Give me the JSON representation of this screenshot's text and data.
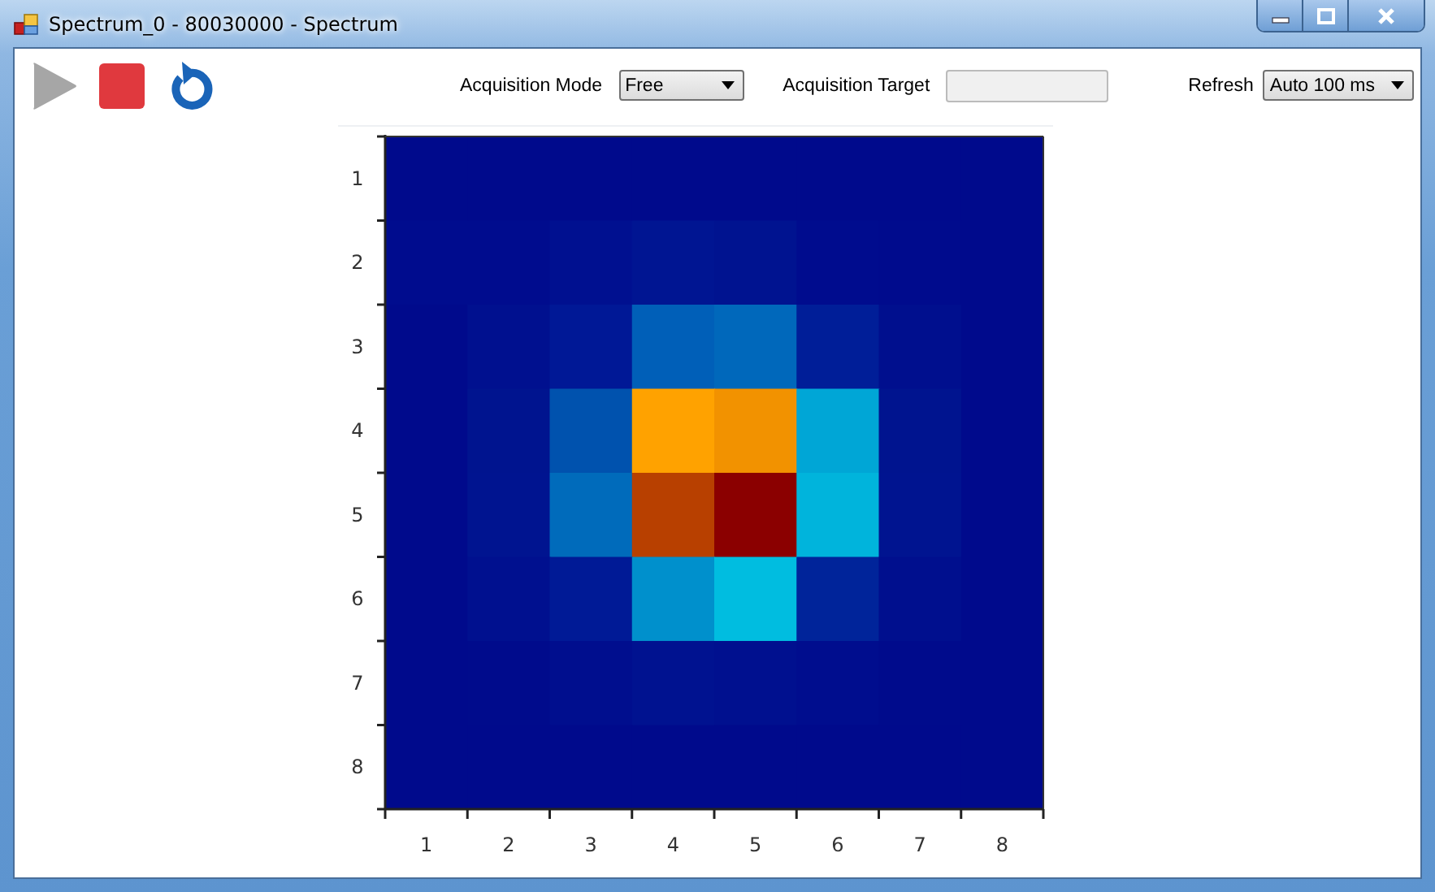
{
  "window": {
    "title": "Spectrum_0 - 80030000 - Spectrum"
  },
  "toolbar": [
    {
      "kind": "play",
      "disabled": true
    },
    {
      "kind": "stop",
      "disabled": false
    },
    {
      "kind": "reset",
      "disabled": false
    }
  ],
  "acquisition_mode": {
    "label": "Acquisition Mode",
    "value": "Free"
  },
  "acquisition_target": {
    "label": "Acquisition Target",
    "disabled": true
  },
  "refresh": {
    "label": "Refresh",
    "value": "Auto 100 ms"
  },
  "heatmap": {
    "y_ticks": [
      "1",
      "2",
      "3",
      "4",
      "5",
      "6",
      "7",
      "8"
    ],
    "x_ticks": [
      "1",
      "2",
      "3",
      "4",
      "5",
      "6",
      "7",
      "8"
    ],
    "rows": [
      {
        "cells": [
          {
            "color": "#000a8c"
          },
          {
            "color": "#000a8c"
          },
          {
            "color": "#000a8c"
          },
          {
            "color": "#000a8c"
          },
          {
            "color": "#000a8c"
          },
          {
            "color": "#000a8c"
          },
          {
            "color": "#000a8c"
          },
          {
            "color": "#000a8c"
          }
        ]
      },
      {
        "cells": [
          {
            "color": "#000c8e"
          },
          {
            "color": "#000c8e"
          },
          {
            "color": "#001090"
          },
          {
            "color": "#001592"
          },
          {
            "color": "#001390"
          },
          {
            "color": "#000c8e"
          },
          {
            "color": "#000b8d"
          },
          {
            "color": "#000a8c"
          }
        ]
      },
      {
        "cells": [
          {
            "color": "#000a8c"
          },
          {
            "color": "#00108f"
          },
          {
            "color": "#001896"
          },
          {
            "color": "#005fb8"
          },
          {
            "color": "#0068bb"
          },
          {
            "color": "#001e98"
          },
          {
            "color": "#000f8e"
          },
          {
            "color": "#000a8c"
          }
        ]
      },
      {
        "cells": [
          {
            "color": "#000a8c"
          },
          {
            "color": "#00148f"
          },
          {
            "color": "#0052ae"
          },
          {
            "color": "#ffa200"
          },
          {
            "color": "#f29200"
          },
          {
            "color": "#00a6d6"
          },
          {
            "color": "#00148f"
          },
          {
            "color": "#000a8c"
          }
        ]
      },
      {
        "cells": [
          {
            "color": "#000a8c"
          },
          {
            "color": "#001490"
          },
          {
            "color": "#006bbb"
          },
          {
            "color": "#b84000"
          },
          {
            "color": "#8b0000"
          },
          {
            "color": "#00b4dc"
          },
          {
            "color": "#001490"
          },
          {
            "color": "#000a8c"
          }
        ]
      },
      {
        "cells": [
          {
            "color": "#000a8c"
          },
          {
            "color": "#00108f"
          },
          {
            "color": "#001a96"
          },
          {
            "color": "#0090cc"
          },
          {
            "color": "#00bde0"
          },
          {
            "color": "#00249a"
          },
          {
            "color": "#000f8e"
          },
          {
            "color": "#000a8c"
          }
        ]
      },
      {
        "cells": [
          {
            "color": "#000a8c"
          },
          {
            "color": "#000b8c"
          },
          {
            "color": "#000e8e"
          },
          {
            "color": "#001290"
          },
          {
            "color": "#00108f"
          },
          {
            "color": "#000d8e"
          },
          {
            "color": "#000b8c"
          },
          {
            "color": "#000a8c"
          }
        ]
      },
      {
        "cells": [
          {
            "color": "#000a8c"
          },
          {
            "color": "#000a8c"
          },
          {
            "color": "#000a8c"
          },
          {
            "color": "#000a8c"
          },
          {
            "color": "#000a8c"
          },
          {
            "color": "#000a8c"
          },
          {
            "color": "#000a8c"
          },
          {
            "color": "#000a8c"
          }
        ]
      }
    ]
  }
}
